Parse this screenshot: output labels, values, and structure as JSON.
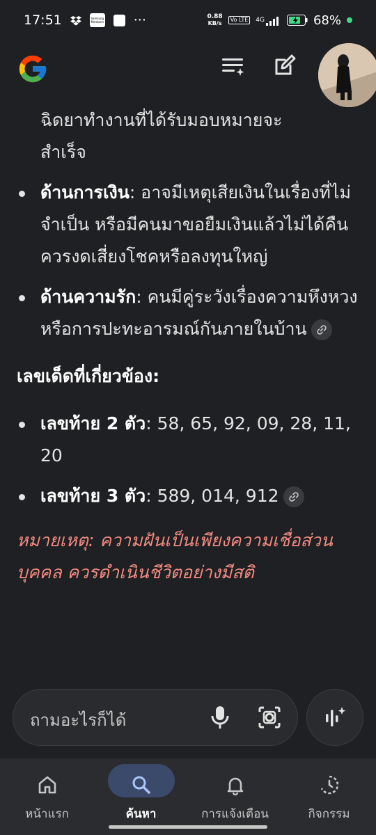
{
  "status_bar": {
    "time": "17:51",
    "app_icon_label": "Samsung Members",
    "net_speed_value": "0.88",
    "net_speed_unit": "KB/s",
    "volte": "Vo LTE",
    "signal": "4G",
    "battery": "68%"
  },
  "header": {
    "logo": "google-g-logo",
    "history_icon": "list-sparkle-icon",
    "compose_icon": "edit-icon"
  },
  "content": {
    "intro_line1": "ฉิดยาทำงานที่ได้รับมอบหมายจะ",
    "intro_line2": "สำเร็จ",
    "bullets": [
      {
        "label": "ด้านการเงิน",
        "text": ": อาจมีเหตุเสียเงินในเรื่องที่ไม่จำเป็น หรือมีคนมาขอยืมเงินแล้วไม่ได้คืน ควรงดเสี่ยงโชคหรือลงทุนใหญ่"
      },
      {
        "label": "ด้านความรัก",
        "text": ": คนมีคู่ระวังเรื่องความหึงหวง หรือการปะทะอารมณ์กันภายในบ้าน"
      }
    ],
    "lucky_heading": "เลขเด็ดที่เกี่ยวข้อง:",
    "numbers": [
      {
        "label": "เลขท้าย 2 ตัว",
        "text": ": 58, 65, 92, 09, 28, 11, 20"
      },
      {
        "label": "เลขท้าย 3 ตัว",
        "text": ": 589, 014, 912"
      }
    ],
    "note": "หมายเหตุ: ความฝันเป็นเพียงความเชื่อส่วนบุคคล ควรดำเนินชีวิตอย่างมีสติ"
  },
  "search": {
    "placeholder": "ถามอะไรก็ได้"
  },
  "nav": {
    "items": [
      {
        "label": "หน้าแรก",
        "icon": "home-icon"
      },
      {
        "label": "ค้นหา",
        "icon": "search-icon"
      },
      {
        "label": "การแจ้งเตือน",
        "icon": "bell-icon"
      },
      {
        "label": "กิจกรรม",
        "icon": "activity-icon"
      }
    ],
    "active_index": 1
  },
  "colors": {
    "background": "#1f2023",
    "note": "#f28b82",
    "active_pill": "#3b4a6b"
  }
}
